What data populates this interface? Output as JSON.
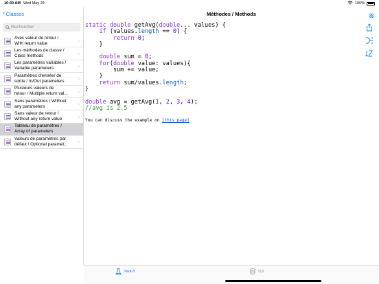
{
  "status_bar": {
    "time": "10:30 AM",
    "date": "Wed May 29",
    "battery": "100%"
  },
  "sidebar": {
    "back_label": "Classes",
    "search": {
      "placeholder": "Rechercher"
    },
    "items": [
      {
        "line1": "Avec valeur de retour /",
        "line2": "With return value"
      },
      {
        "line1": "Les méthodes de classe /",
        "line2": "Class methods"
      },
      {
        "line1": "Les paramètres variables /",
        "line2": "Variable parameters"
      },
      {
        "line1": "Paramètres d'entrée/ de",
        "line2": "sortie / In/Out parameters"
      },
      {
        "line1": "Plusieurs valeurs de",
        "line2": "retour / Multiple return val..."
      },
      {
        "line1": "Sans paramètres / Without",
        "line2": "any parameters"
      },
      {
        "line1": "Sans valeur de retour /",
        "line2": "Without any return value"
      },
      {
        "line1": "Tableau de paramètres /",
        "line2": "Array of parameters",
        "selected": true
      },
      {
        "line1": "Valeurs de paramètres par",
        "line2": "défaut / Optional paramet..."
      }
    ]
  },
  "header": {
    "title": "Méthodes / Methods"
  },
  "code": {
    "t_static": "static",
    "t_double": "double",
    "t_method": " getAvg(",
    "t_varargs": "double",
    "t_dots": "... values) {",
    "t_if": "if",
    "t_if_open": " (values.",
    "t_length": "length",
    "t_eq": " == ",
    "t_zero": "0",
    "t_if_close": ") {",
    "t_return": "return",
    "t_ret_zero": "0",
    "t_semicolon": ";",
    "t_sum_type": "double",
    "t_sum_decl": " sum = ",
    "t_sum_zero": "0",
    "t_for": "for",
    "t_for_open": "(",
    "t_for_type": "double",
    "t_for_rest": " value: values){",
    "t_sum_add": "sum += value;",
    "t_return2": "return",
    "t_ret_expr": " sum/values.",
    "t_length2": "length",
    "t_avg_type": "double",
    "t_avg_call": " avg = getAvg(",
    "t_a1": "1",
    "t_a2": "2",
    "t_a3": "3",
    "t_a4": "4",
    "t_comment": "//avg is 2.5"
  },
  "note": {
    "prefix": "You can discuss the example on ",
    "link": "[this page]"
  },
  "tabs": [
    {
      "label": "Java 8",
      "icon": "flask-icon",
      "active": true
    },
    {
      "label": "SQL",
      "icon": "database-icon",
      "active": false
    }
  ],
  "colors": {
    "accent": "#0a7aff",
    "keyword": "#8a2be2",
    "number": "#5a00ff",
    "comment": "#2a8a2a",
    "selected_row": "#d1d1d6"
  }
}
